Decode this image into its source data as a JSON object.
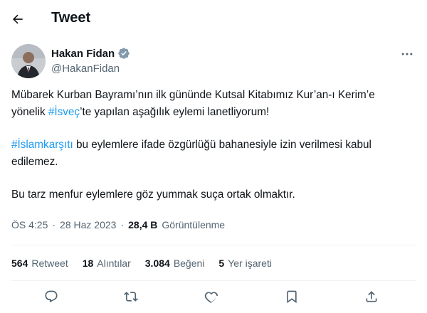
{
  "header": {
    "title": "Tweet"
  },
  "author": {
    "name": "Hakan Fidan",
    "handle": "@HakanFidan"
  },
  "tweet": {
    "line1_part1": "Mübarek Kurban Bayramı’nın ilk gününde Kutsal Kitabımız Kur’an-ı Kerim’e",
    "line2_prefix": "yönelik ",
    "hashtag1": "#İsveç",
    "line2_suffix": "’te yapılan aşağılık eylemi lanetliyorum!",
    "hashtag2": "#İslamkarşıtı",
    "para2_suffix": " bu eylemlere ifade özgürlüğü bahanesiyle izin verilmesi kabul edilemez.",
    "para3": "Bu tarz menfur eylemlere göz yummak suça ortak olmaktır."
  },
  "meta": {
    "time": "ÖS 4:25",
    "separator": "·",
    "date": "28 Haz 2023",
    "views_count": "28,4 B",
    "views_label": "Görüntülenme"
  },
  "stats": {
    "retweets_count": "564",
    "retweets_label": "Retweet",
    "quotes_count": "18",
    "quotes_label": "Alıntılar",
    "likes_count": "3.084",
    "likes_label": "Beğeni",
    "bookmarks_count": "5",
    "bookmarks_label": "Yer işareti"
  },
  "colors": {
    "accent": "#1d9bf0",
    "text": "#0f1419",
    "secondary": "#536471"
  }
}
